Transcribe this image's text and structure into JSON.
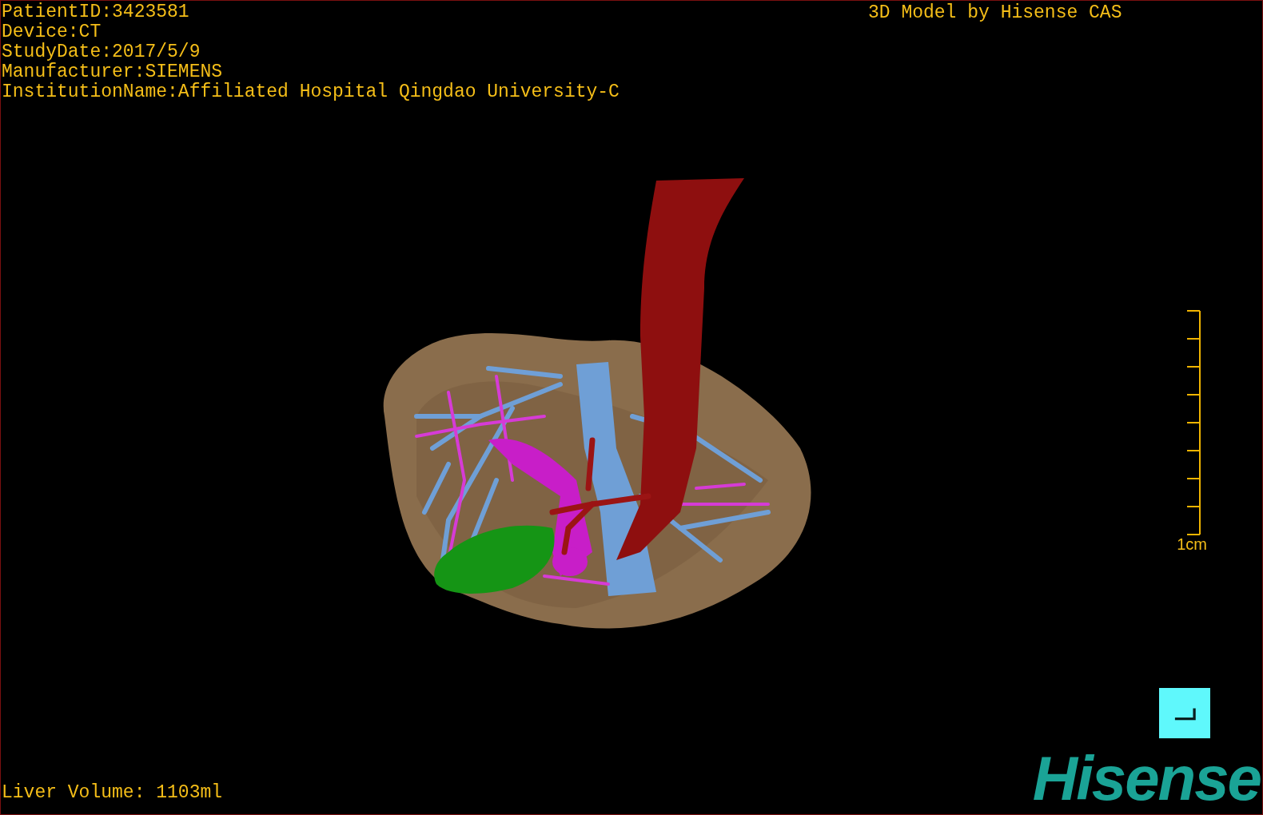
{
  "patient_info": [
    "PatientID:3423581",
    "Device:CT",
    "StudyDate:2017/5/9",
    "Manufacturer:SIEMENS",
    "InstitutionName:Affiliated Hospital Qingdao University-C"
  ],
  "title_text": "3D Model by Hisense CAS",
  "scale_bar": {
    "label": "1cm"
  },
  "liver_volume": "Liver Volume: 1103ml",
  "logo": "Hisense"
}
